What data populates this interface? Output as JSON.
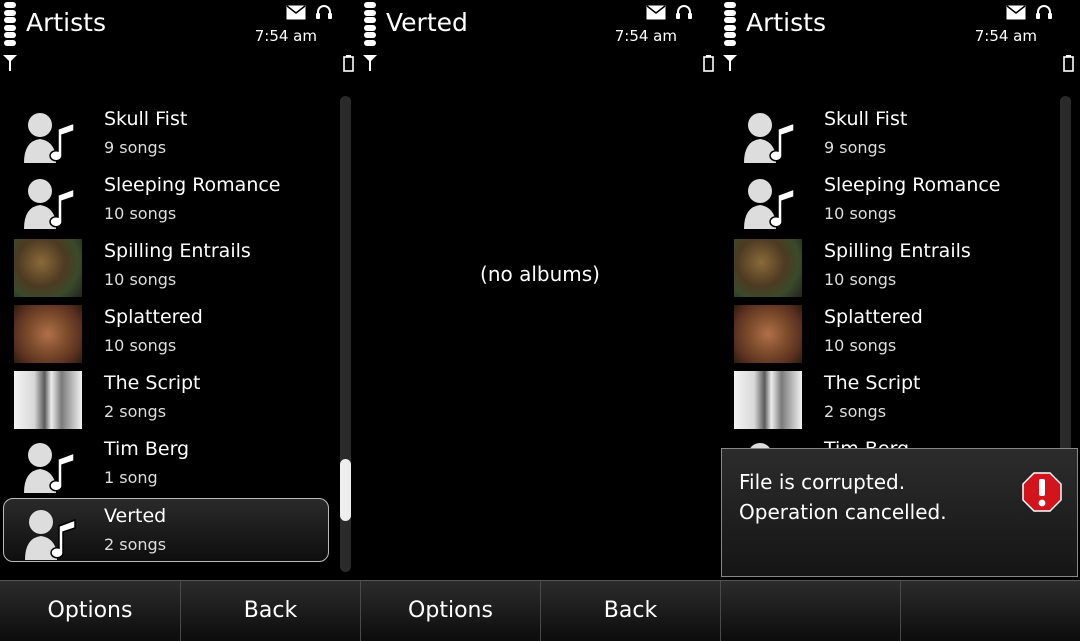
{
  "status": {
    "time": "7:54 am"
  },
  "panels": [
    {
      "title": "Artists",
      "items": [
        {
          "name": "Skull Fist",
          "count": "9 songs",
          "thumb": "artist-placeholder-icon"
        },
        {
          "name": "Sleeping Romance",
          "count": "10 songs",
          "thumb": "artist-placeholder-icon"
        },
        {
          "name": "Spilling Entrails",
          "count": "10 songs",
          "thumb": "album-art"
        },
        {
          "name": "Splattered",
          "count": "10 songs",
          "thumb": "album-art"
        },
        {
          "name": "The Script",
          "count": "2 songs",
          "thumb": "album-art"
        },
        {
          "name": "Tim Berg",
          "count": "1 song",
          "thumb": "artist-placeholder-icon"
        },
        {
          "name": "Verted",
          "count": "2 songs",
          "thumb": "artist-placeholder-icon",
          "selected": true
        }
      ]
    },
    {
      "title": "Verted",
      "empty_text": "(no albums)"
    },
    {
      "title": "Artists",
      "items": [
        {
          "name": "Skull Fist",
          "count": "9 songs"
        },
        {
          "name": "Sleeping Romance",
          "count": "10 songs"
        },
        {
          "name": "Spilling Entrails",
          "count": "10 songs"
        },
        {
          "name": "Splattered",
          "count": "10 songs"
        },
        {
          "name": "The Script",
          "count": "2 songs"
        },
        {
          "name": "Tim Berg",
          "count": ""
        }
      ]
    }
  ],
  "softkeys": [
    "Options",
    "Back",
    "Options",
    "Back",
    "",
    ""
  ],
  "dialog": {
    "message": "File is corrupted. Operation cancelled.",
    "icon": "error-icon"
  },
  "colors": {
    "background": "#000000",
    "error_red": "#d4141c"
  }
}
